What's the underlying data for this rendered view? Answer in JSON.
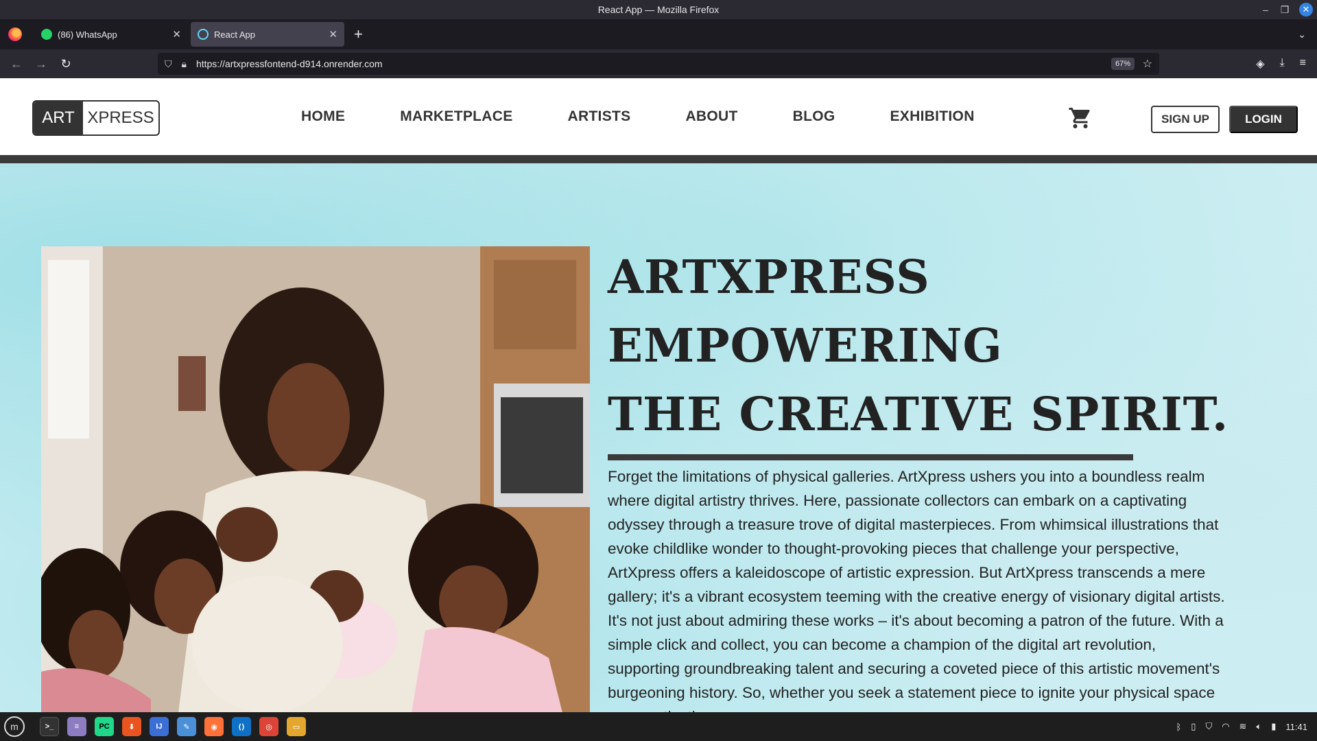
{
  "window": {
    "title": "React App — Mozilla Firefox"
  },
  "tabs": [
    {
      "label": "(86) WhatsApp",
      "icon": "whatsapp-icon"
    },
    {
      "label": "React App",
      "icon": "react-icon"
    }
  ],
  "urlbar": {
    "url": "https://artxpressfontend-d914.onrender.com",
    "zoom": "67%"
  },
  "site": {
    "logo_left": "ART",
    "logo_right": "XPRESS",
    "nav": [
      "HOME",
      "MARKETPLACE",
      "ARTISTS",
      "ABOUT",
      "BLOG",
      "EXHIBITION"
    ],
    "signup": "SIGN UP",
    "login": "LOGIN",
    "cart_icon": "cart-icon"
  },
  "hero": {
    "headline": [
      "ARTXPRESS",
      "EMPOWERING",
      "THE CREATIVE SPIRIT."
    ],
    "paragraph": "Forget the limitations of physical galleries. ArtXpress ushers you into a boundless realm where digital artistry thrives. Here, passionate collectors can embark on a captivating odyssey through a treasure trove of digital masterpieces. From whimsical illustrations that evoke childlike wonder to thought-provoking pieces that challenge your perspective, ArtXpress offers a kaleidoscope of artistic expression. But ArtXpress transcends a mere gallery; it's a vibrant ecosystem teeming with the creative energy of visionary digital artists. It's not just about admiring these works – it's about becoming a patron of the future. With a simple click and collect, you can become a champion of the digital art revolution, supporting groundbreaking talent and securing a coveted piece of this artistic movement's burgeoning history. So, whether you seek a statement piece to ignite your physical space or a captivating"
  },
  "taskbar": {
    "clock": "11:41",
    "apps": [
      "terminal-icon",
      "text-editor-icon",
      "pycharm-icon",
      "software-center-icon",
      "intellij-icon",
      "notes-icon",
      "firefox-icon",
      "vscode-icon",
      "chrome-icon",
      "files-icon"
    ]
  },
  "colors": {
    "accent": "#333333",
    "hero_bg": "#cdeef2",
    "browser_chrome": "#2b2a33"
  }
}
